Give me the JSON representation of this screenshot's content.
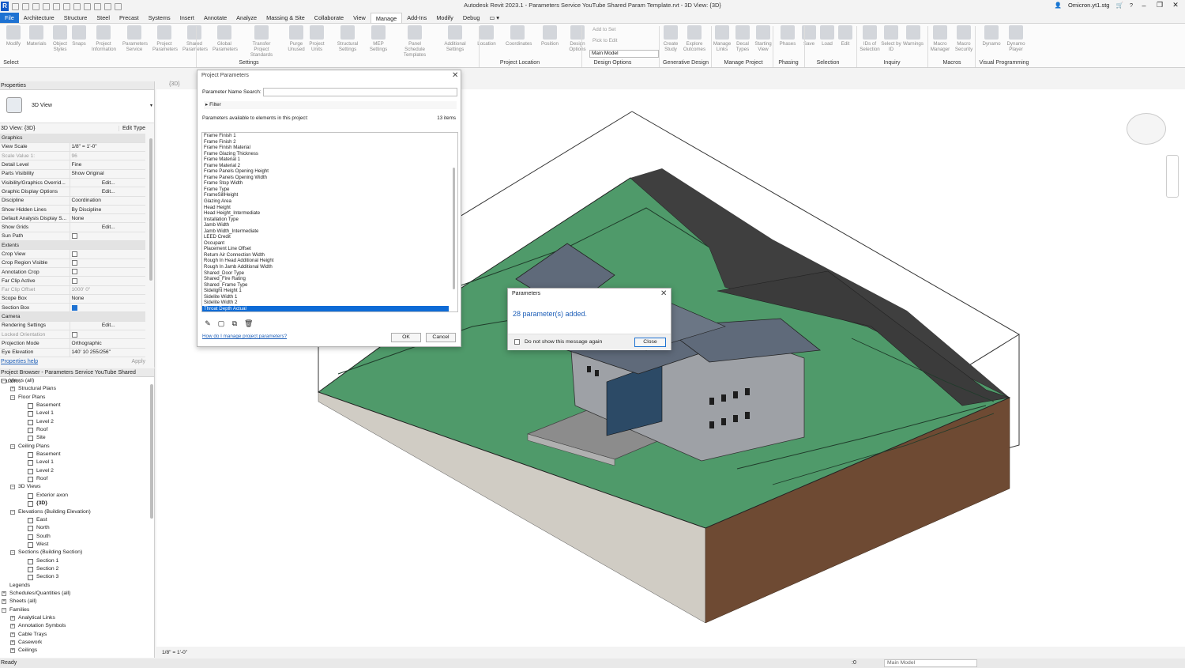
{
  "app": {
    "logo": "R",
    "title": "Autodesk Revit 2023.1 - Parameters Service YouTube Shared Param Template.rvt - 3D View: {3D}",
    "user": "Omicron.yt1.stg",
    "window_controls": [
      "–",
      "❐",
      "✕"
    ]
  },
  "ribbon": {
    "tabs": [
      "File",
      "Architecture",
      "Structure",
      "Steel",
      "Precast",
      "Systems",
      "Insert",
      "Annotate",
      "Analyze",
      "Massing & Site",
      "Collaborate",
      "View",
      "Manage",
      "Add-Ins",
      "Modify",
      "Debug"
    ],
    "active_tab": "Manage",
    "buttons": [
      "Modify",
      "Materials",
      "Object Styles",
      "Snaps",
      "Project Information",
      "Parameters Service",
      "Project Parameters",
      "Shared Parameters",
      "Global Parameters",
      "Transfer Project Standards",
      "Purge Unused",
      "Project Units",
      "Structural Settings",
      "MEP Settings",
      "Panel Schedule Templates",
      "Additional Settings",
      "Location",
      "Coordinates",
      "Position",
      "Design Options",
      "Create Study",
      "Explore Outcomes",
      "Manage Links",
      "Decal Types",
      "Starting View",
      "Phases",
      "Save",
      "Load",
      "Edit",
      "IDs of Selection",
      "Select by ID",
      "Warnings",
      "Macro Manager",
      "Macro Security",
      "Dynamo",
      "Dynamo Player"
    ],
    "small_buttons": [
      "Add to Set",
      "Pick to Edit"
    ],
    "design_option": "Main Model",
    "panels": [
      "Select",
      "Settings",
      "Project Location",
      "Design Options",
      "Generative Design",
      "Manage Project",
      "Phasing",
      "Selection",
      "Inquiry",
      "Macros",
      "Visual Programming"
    ]
  },
  "properties": {
    "header": "Properties",
    "type_name": "3D View",
    "view_selector": "3D View: {3D}",
    "edit_type": "Edit Type",
    "groups": [
      {
        "name": "Graphics",
        "rows": [
          {
            "k": "View Scale",
            "v": "1/8\" = 1'-0\""
          },
          {
            "k": "Scale Value    1:",
            "v": "96",
            "dis": true
          },
          {
            "k": "Detail Level",
            "v": "Fine"
          },
          {
            "k": "Parts Visibility",
            "v": "Show Original"
          },
          {
            "k": "Visibility/Graphics Overrid...",
            "v": "Edit...",
            "btn": true
          },
          {
            "k": "Graphic Display Options",
            "v": "Edit...",
            "btn": true
          },
          {
            "k": "Discipline",
            "v": "Coordination"
          },
          {
            "k": "Show Hidden Lines",
            "v": "By Discipline"
          },
          {
            "k": "Default Analysis Display S...",
            "v": "None"
          },
          {
            "k": "Show Grids",
            "v": "Edit...",
            "btn": true
          },
          {
            "k": "Sun Path",
            "chk": false
          }
        ]
      },
      {
        "name": "Extents",
        "rows": [
          {
            "k": "Crop View",
            "chk": false
          },
          {
            "k": "Crop Region Visible",
            "chk": false
          },
          {
            "k": "Annotation Crop",
            "chk": false
          },
          {
            "k": "Far Clip Active",
            "chk": false
          },
          {
            "k": "Far Clip Offset",
            "v": "1000'  0\"",
            "dis": true
          },
          {
            "k": "Scope Box",
            "v": "None"
          },
          {
            "k": "Section Box",
            "chk": true
          }
        ]
      },
      {
        "name": "Camera",
        "rows": [
          {
            "k": "Rendering Settings",
            "v": "Edit...",
            "btn": true
          },
          {
            "k": "Locked Orientation",
            "chk": false,
            "dis": true
          },
          {
            "k": "Projection Mode",
            "v": "Orthographic"
          },
          {
            "k": "Eye Elevation",
            "v": "140'  10 255/256\""
          }
        ]
      }
    ],
    "help_link": "Properties help",
    "apply": "Apply"
  },
  "browser": {
    "header": "Project Browser - Parameters Service YouTube Shared Param...",
    "items": [
      {
        "label": "Views (all)",
        "level": 0,
        "toggle": "-"
      },
      {
        "label": "Structural Plans",
        "level": 1,
        "toggle": "+"
      },
      {
        "label": "Floor Plans",
        "level": 1,
        "toggle": "-"
      },
      {
        "label": "Basement",
        "level": 2
      },
      {
        "label": "Level 1",
        "level": 2
      },
      {
        "label": "Level 2",
        "level": 2
      },
      {
        "label": "Roof",
        "level": 2
      },
      {
        "label": "Site",
        "level": 2
      },
      {
        "label": "Ceiling Plans",
        "level": 1,
        "toggle": "-"
      },
      {
        "label": "Basement",
        "level": 2
      },
      {
        "label": "Level 1",
        "level": 2
      },
      {
        "label": "Level 2",
        "level": 2
      },
      {
        "label": "Roof",
        "level": 2
      },
      {
        "label": "3D Views",
        "level": 1,
        "toggle": "-"
      },
      {
        "label": "Exterior axon",
        "level": 2
      },
      {
        "label": "{3D}",
        "level": 2,
        "bold": true
      },
      {
        "label": "Elevations (Building Elevation)",
        "level": 1,
        "toggle": "-"
      },
      {
        "label": "East",
        "level": 2
      },
      {
        "label": "North",
        "level": 2
      },
      {
        "label": "South",
        "level": 2
      },
      {
        "label": "West",
        "level": 2
      },
      {
        "label": "Sections (Building Section)",
        "level": 1,
        "toggle": "-"
      },
      {
        "label": "Section 1",
        "level": 2
      },
      {
        "label": "Section 2",
        "level": 2
      },
      {
        "label": "Section 3",
        "level": 2
      },
      {
        "label": "Legends",
        "level": 0
      },
      {
        "label": "Schedules/Quantities (all)",
        "level": 0,
        "toggle": "+"
      },
      {
        "label": "Sheets (all)",
        "level": 0,
        "toggle": "+"
      },
      {
        "label": "Families",
        "level": 0,
        "toggle": "-"
      },
      {
        "label": "Analytical Links",
        "level": 1,
        "toggle": "+"
      },
      {
        "label": "Annotation Symbols",
        "level": 1,
        "toggle": "+"
      },
      {
        "label": "Cable Trays",
        "level": 1,
        "toggle": "+"
      },
      {
        "label": "Casework",
        "level": 1,
        "toggle": "+"
      },
      {
        "label": "Ceilings",
        "level": 1,
        "toggle": "+"
      }
    ]
  },
  "view": {
    "tab": "{3D}",
    "scale": "1/8\" = 1'-0\""
  },
  "status": {
    "text": "Ready",
    "worksets": ":0",
    "model": "Main Model"
  },
  "project_params_dialog": {
    "title": "Project Parameters",
    "search_label": "Parameter Name Search:",
    "search_value": "",
    "filter": "Filter",
    "available_label": "Parameters available to elements in this project:",
    "count": "13 items",
    "items": [
      "Frame Finish 1",
      "Frame Finish 2",
      "Frame Finish Material",
      "Frame Glazing Thickness",
      "Frame Material 1",
      "Frame Material 2",
      "Frame Panels Opening Height",
      "Frame Panels Opening Width",
      "Frame Stop Width",
      "Frame Type",
      "FrameSillHeight",
      "Glazing Area",
      "Head Height",
      "Head Height_Intermediate",
      "Installation Type",
      "Jamb Width",
      "Jamb Width_Intermediate",
      "LEED Credit",
      "Occupant",
      "Placement Line Offset",
      "Return Air Connection Width",
      "Rough In Head Additional Height",
      "Rough In Jamb Additional Width",
      "Shared_Door Type",
      "Shared_Fire Rating",
      "Shared_Frame Type",
      "Sidelight Height 1",
      "Sidelite Width 1",
      "Sidelite Width 2",
      "Throat Depth Actual"
    ],
    "selected": "Throat Depth Actual",
    "help": "How do I manage project parameters?",
    "ok": "OK",
    "cancel": "Cancel"
  },
  "message_dialog": {
    "title": "Parameters",
    "message": "28 parameter(s) added.",
    "checkbox_label": "Do not show this message again",
    "close": "Close"
  },
  "colors": {
    "accent": "#1e72d2",
    "selection": "#0e6bd6",
    "terrain_green": "#4f9a6a",
    "soil": "#5a3a26",
    "roof": "#5f6a7a"
  }
}
